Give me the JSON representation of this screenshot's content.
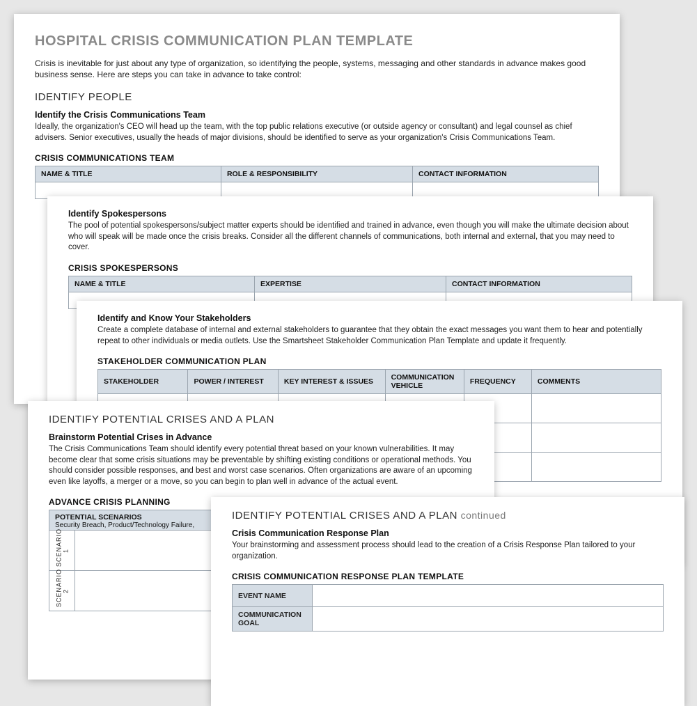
{
  "page1": {
    "title": "HOSPITAL CRISIS COMMUNICATION PLAN TEMPLATE",
    "intro": "Crisis is inevitable for just about any type of organization, so identifying the people, systems, messaging and other standards in advance makes good business sense. Here are steps you can take in advance to take control:",
    "section": "IDENTIFY PEOPLE",
    "sub": "Identify the Crisis Communications Team",
    "body": "Ideally, the organization's CEO will head up the team, with the top public relations executive (or outside agency or consultant) and legal counsel as chief advisers. Senior executives, usually the heads of major divisions, should be identified to serve as your organization's Crisis Communications Team.",
    "tableTitle": "CRISIS COMMUNICATIONS TEAM",
    "cols": {
      "c1": "NAME & TITLE",
      "c2": "ROLE & RESPONSIBILITY",
      "c3": "CONTACT INFORMATION"
    }
  },
  "page2": {
    "sub": "Identify Spokespersons",
    "body": "The pool of potential spokespersons/subject matter experts should be identified and trained in advance, even though you will make the ultimate decision about who will speak will be made once the crisis breaks. Consider all the different channels of communications, both internal and external, that you may need to cover.",
    "tableTitle": "CRISIS SPOKESPERSONS",
    "cols": {
      "c1": "NAME & TITLE",
      "c2": "EXPERTISE",
      "c3": "CONTACT INFORMATION"
    }
  },
  "page3": {
    "sub": "Identify and Know Your Stakeholders",
    "body": "Create a complete database of internal and external stakeholders to guarantee that they obtain the exact messages you want them to hear and potentially repeat to other individuals or media outlets. Use the Smartsheet Stakeholder Communication Plan Template and update it frequently.",
    "tableTitle": "STAKEHOLDER COMMUNICATION PLAN",
    "cols": {
      "c1": "STAKEHOLDER",
      "c2": "POWER / INTEREST",
      "c3": "KEY INTEREST & ISSUES",
      "c4": "COMMUNICATION VEHICLE",
      "c5": "FREQUENCY",
      "c6": "COMMENTS"
    }
  },
  "page4": {
    "section": "IDENTIFY POTENTIAL CRISES AND A PLAN",
    "sub": "Brainstorm Potential Crises in Advance",
    "body": "The Crisis Communications Team should identify every potential threat based on your known vulnerabilities. It may become clear that some crisis situations may be preventable by shifting existing conditions or operational methods. You should consider possible responses, and best and worst case scenarios. Often organizations are aware of an upcoming even like layoffs, a merger or a move, so you can begin to plan well in advance of the actual event.",
    "tableTitle": "ADVANCE CRISIS PLANNING",
    "scenHeader": "POTENTIAL SCENARIOS",
    "scenSub": "Security Breach, Product/Technology Failure,",
    "s1": "SCENARIO 1",
    "s2": "SCENARIO 2"
  },
  "page5": {
    "section": "IDENTIFY POTENTIAL CRISES AND A PLAN",
    "cont": "continued",
    "sub": "Crisis Communication Response Plan",
    "body": "Your brainstorming and assessment process should lead to the creation of a Crisis Response Plan tailored to your organization.",
    "tableTitle": "CRISIS COMMUNICATION RESPONSE PLAN TEMPLATE",
    "r1": "EVENT NAME",
    "r2": "COMMUNICATION GOAL"
  }
}
